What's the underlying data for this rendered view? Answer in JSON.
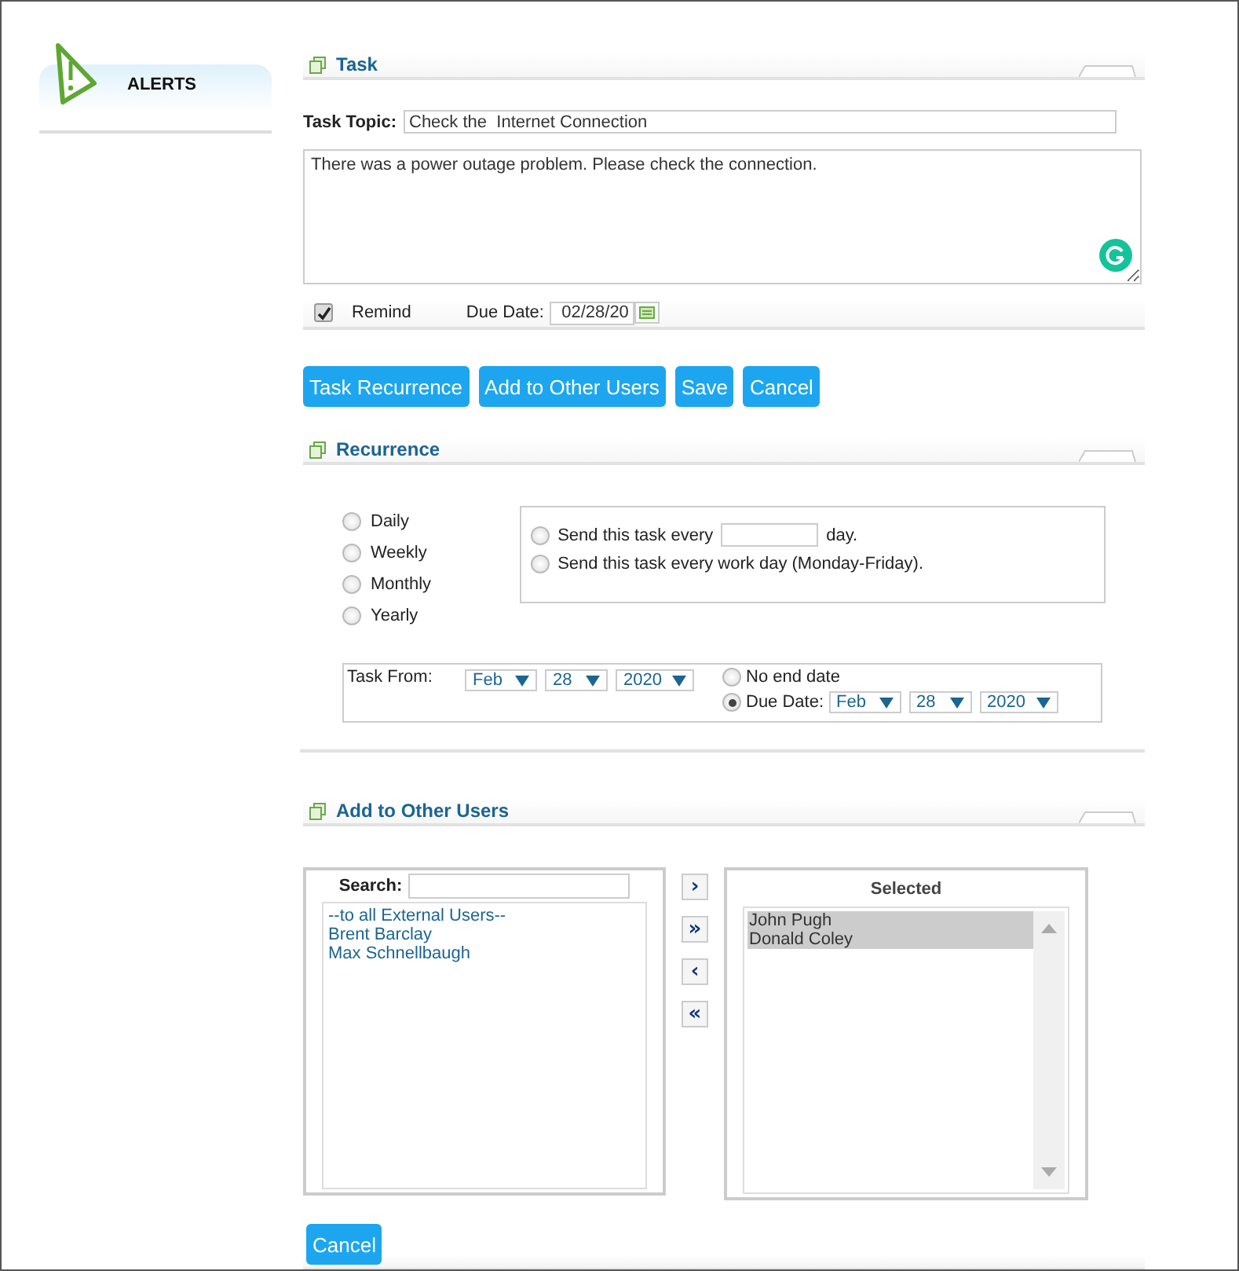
{
  "sidebar": {
    "title": "ALERTS"
  },
  "task": {
    "heading": "Task",
    "topic_label": "Task Topic:",
    "topic_value": "Check the  Internet Connection",
    "description": "There was a power outage problem. Please check the connection.",
    "remind": {
      "label": "Remind",
      "checked": true
    },
    "due_date": {
      "label": "Due Date:",
      "value": "02/28/20"
    }
  },
  "buttons": [
    "Task Recurrence",
    "Add to Other Users",
    "Save",
    "Cancel"
  ],
  "recurrence": {
    "heading": "Recurrence",
    "frequencies": [
      {
        "label": "Daily",
        "selected": false
      },
      {
        "label": "Weekly",
        "selected": false
      },
      {
        "label": "Monthly",
        "selected": false
      },
      {
        "label": "Yearly",
        "selected": false
      }
    ],
    "options": [
      {
        "kind": "every_n",
        "text_before": "Send this task every",
        "text_after": "day.",
        "selected": false
      },
      {
        "kind": "workday",
        "label": "Send this task every work day (Monday-Friday).",
        "selected": false
      }
    ],
    "task_from": {
      "label": "Task From:",
      "month": "Feb",
      "day": "28",
      "year": "2020"
    },
    "end": [
      {
        "kind": "none",
        "label": "No end date",
        "selected": false
      },
      {
        "kind": "date",
        "label": "Due Date:",
        "month": "Feb",
        "day": "28",
        "year": "2020",
        "selected": true
      }
    ]
  },
  "users": {
    "heading": "Add to Other Users",
    "search_label": "Search:",
    "available": [
      {
        "name": "--to all External Users--",
        "selected": false
      },
      {
        "name": "Brent Barclay",
        "selected": false
      },
      {
        "name": "Max Schnellbaugh",
        "selected": false
      }
    ],
    "transfer_buttons": [
      "›",
      "»",
      "‹",
      "«"
    ],
    "selected_heading": "Selected",
    "selected": [
      {
        "name": "John Pugh",
        "selected": true
      },
      {
        "name": "Donald Coley",
        "selected": true
      }
    ]
  },
  "bottom_button": "Cancel"
}
